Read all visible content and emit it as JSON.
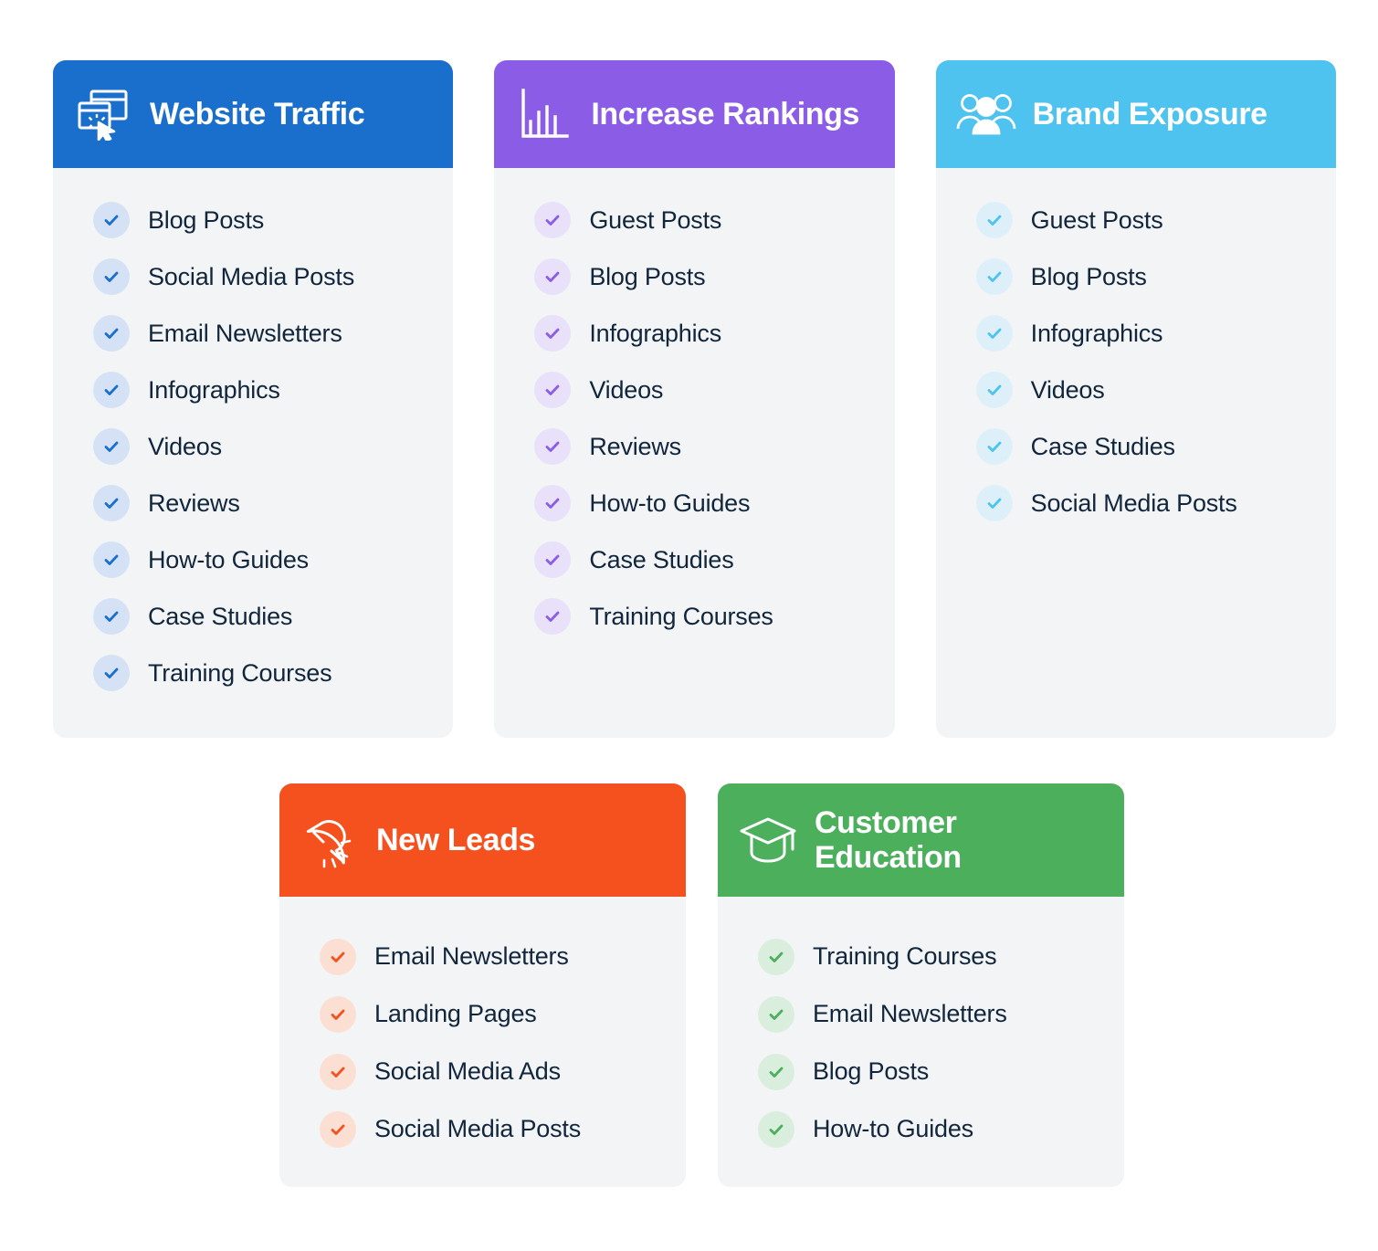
{
  "page": {
    "background_color": "#ffffff",
    "card_body_color": "#f3f4f5",
    "item_text_color": "#11263c"
  },
  "cards": [
    {
      "id": "website-traffic",
      "title": "Website Traffic",
      "icon": "browser-window-cursor-icon",
      "header_color": "#1a6fcd",
      "check_bubble_color": "#d5e2f5",
      "check_mark_color": "#1a6fcd",
      "items": [
        "Blog Posts",
        "Social Media Posts",
        "Email Newsletters",
        "Infographics",
        "Videos",
        "Reviews",
        "How-to Guides",
        "Case Studies",
        "Training Courses"
      ]
    },
    {
      "id": "increase-rankings",
      "title": "Increase Rankings",
      "icon": "bar-chart-icon",
      "header_color": "#8b5ce6",
      "check_bubble_color": "#e9e0fa",
      "check_mark_color": "#8b5ce6",
      "items": [
        "Guest Posts",
        "Blog Posts",
        "Infographics",
        "Videos",
        "Reviews",
        "How-to Guides",
        "Case Studies",
        "Training Courses"
      ]
    },
    {
      "id": "brand-exposure",
      "title": "Brand Exposure",
      "icon": "people-group-icon",
      "header_color": "#4fc3f0",
      "check_bubble_color": "#ddf0f9",
      "check_mark_color": "#4fc3f0",
      "items": [
        "Guest Posts",
        "Blog Posts",
        "Infographics",
        "Videos",
        "Case Studies",
        "Social Media Posts"
      ]
    },
    {
      "id": "new-leads",
      "title": "New Leads",
      "icon": "magnet-icon",
      "header_color": "#f4511e",
      "check_bubble_color": "#fbdfd3",
      "check_mark_color": "#f4511e",
      "items": [
        "Email Newsletters",
        "Landing Pages",
        "Social Media Ads",
        "Social Media Posts"
      ]
    },
    {
      "id": "customer-education",
      "title": "Customer\nEducation",
      "icon": "graduation-cap-icon",
      "header_color": "#4caf5c",
      "check_bubble_color": "#d9eedd",
      "check_mark_color": "#4caf5c",
      "items": [
        "Training Courses",
        "Email Newsletters",
        "Blog Posts",
        "How-to Guides"
      ]
    }
  ]
}
